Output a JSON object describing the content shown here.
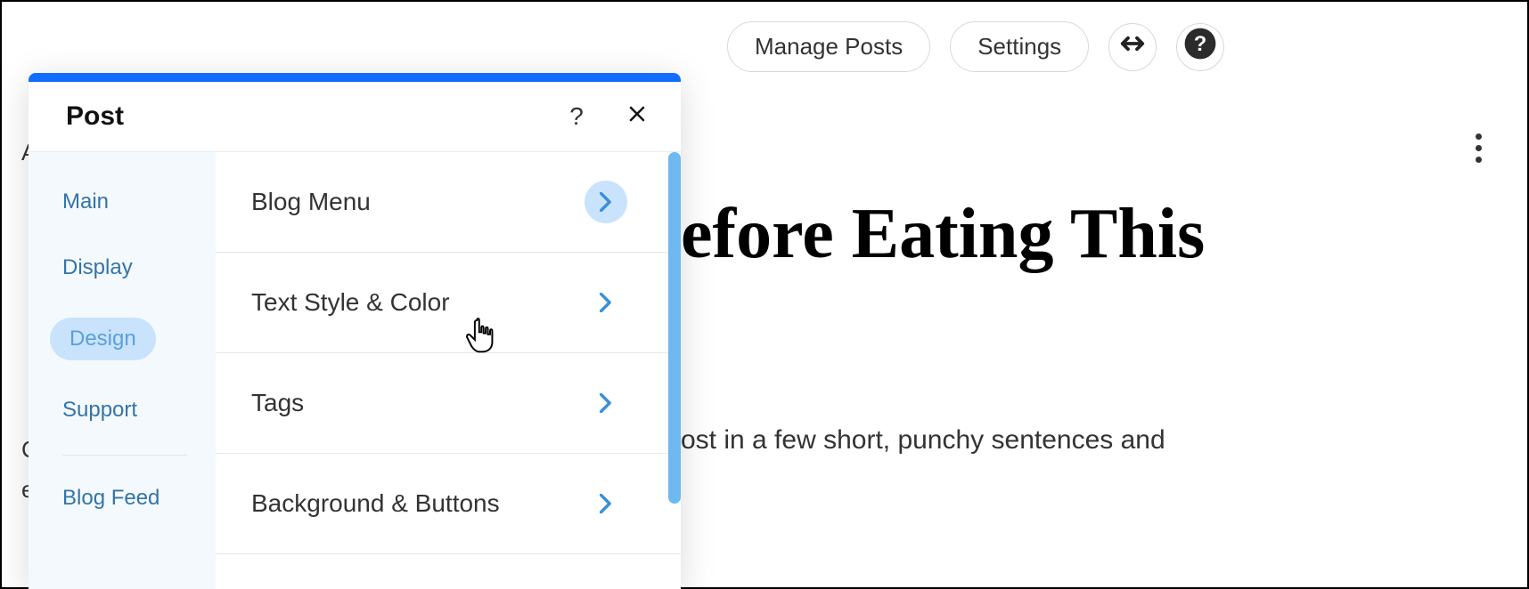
{
  "toolbar": {
    "manage_posts": "Manage Posts",
    "settings": "Settings"
  },
  "post": {
    "heading_visible": "efore Eating This",
    "body_visible": "ost in a few short, punchy sentences and"
  },
  "panel": {
    "title": "Post",
    "nav": {
      "main": "Main",
      "display": "Display",
      "design": "Design",
      "support": "Support",
      "blog_feed": "Blog Feed"
    },
    "design_items": {
      "blog_menu": "Blog Menu",
      "text_style_color": "Text Style & Color",
      "tags": "Tags",
      "background_buttons": "Background & Buttons"
    }
  },
  "left_fragments": {
    "a": "A",
    "c": "C",
    "e": "e"
  }
}
